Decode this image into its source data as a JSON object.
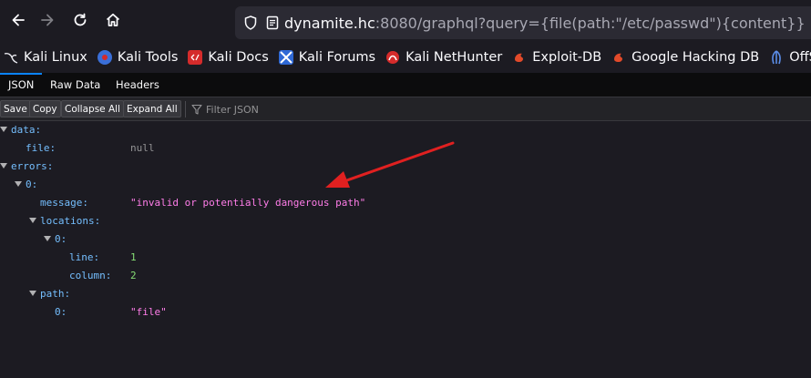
{
  "browser": {
    "url_host": "dynamite.hc",
    "url_rest": ":8080/graphql?query={file(path:\"/etc/passwd\"){content}}",
    "bookmarks": [
      {
        "label": "Kali Linux",
        "icon": "kali-dragon-icon",
        "color": "#1c1b22"
      },
      {
        "label": "Kali Tools",
        "icon": "kali-tools-icon",
        "color": "#3a6fd8"
      },
      {
        "label": "Kali Docs",
        "icon": "kali-docs-icon",
        "color": "#d52b2b"
      },
      {
        "label": "Kali Forums",
        "icon": "kali-forums-icon",
        "color": "#2f69d6"
      },
      {
        "label": "Kali NetHunter",
        "icon": "nethunter-icon",
        "color": "#d52b2b"
      },
      {
        "label": "Exploit-DB",
        "icon": "exploit-db-icon",
        "color": "#e24a2a"
      },
      {
        "label": "Google Hacking DB",
        "icon": "ghdb-icon",
        "color": "#e24a2a"
      },
      {
        "label": "OffSec",
        "icon": "offsec-icon",
        "color": "#5b8de8"
      }
    ]
  },
  "viewer": {
    "tabs": [
      "JSON",
      "Raw Data",
      "Headers"
    ],
    "toolbar": {
      "save": "Save",
      "copy": "Copy",
      "collapse_all": "Collapse All",
      "expand_all": "Expand All",
      "filter_placeholder": "Filter JSON"
    },
    "tree": {
      "data_key": "data:",
      "file_key": "file:",
      "file_value": "null",
      "errors_key": "errors:",
      "error0_key": "0:",
      "message_key": "message:",
      "message_value": "\"invalid or potentially dangerous path\"",
      "locations_key": "locations:",
      "location0_key": "0:",
      "line_key": "line:",
      "line_value": "1",
      "column_key": "column:",
      "column_value": "2",
      "path_key": "path:",
      "path0_key": "0:",
      "path0_value": "\"file\""
    }
  },
  "annotation": {
    "arrow_color": "#e02020"
  }
}
